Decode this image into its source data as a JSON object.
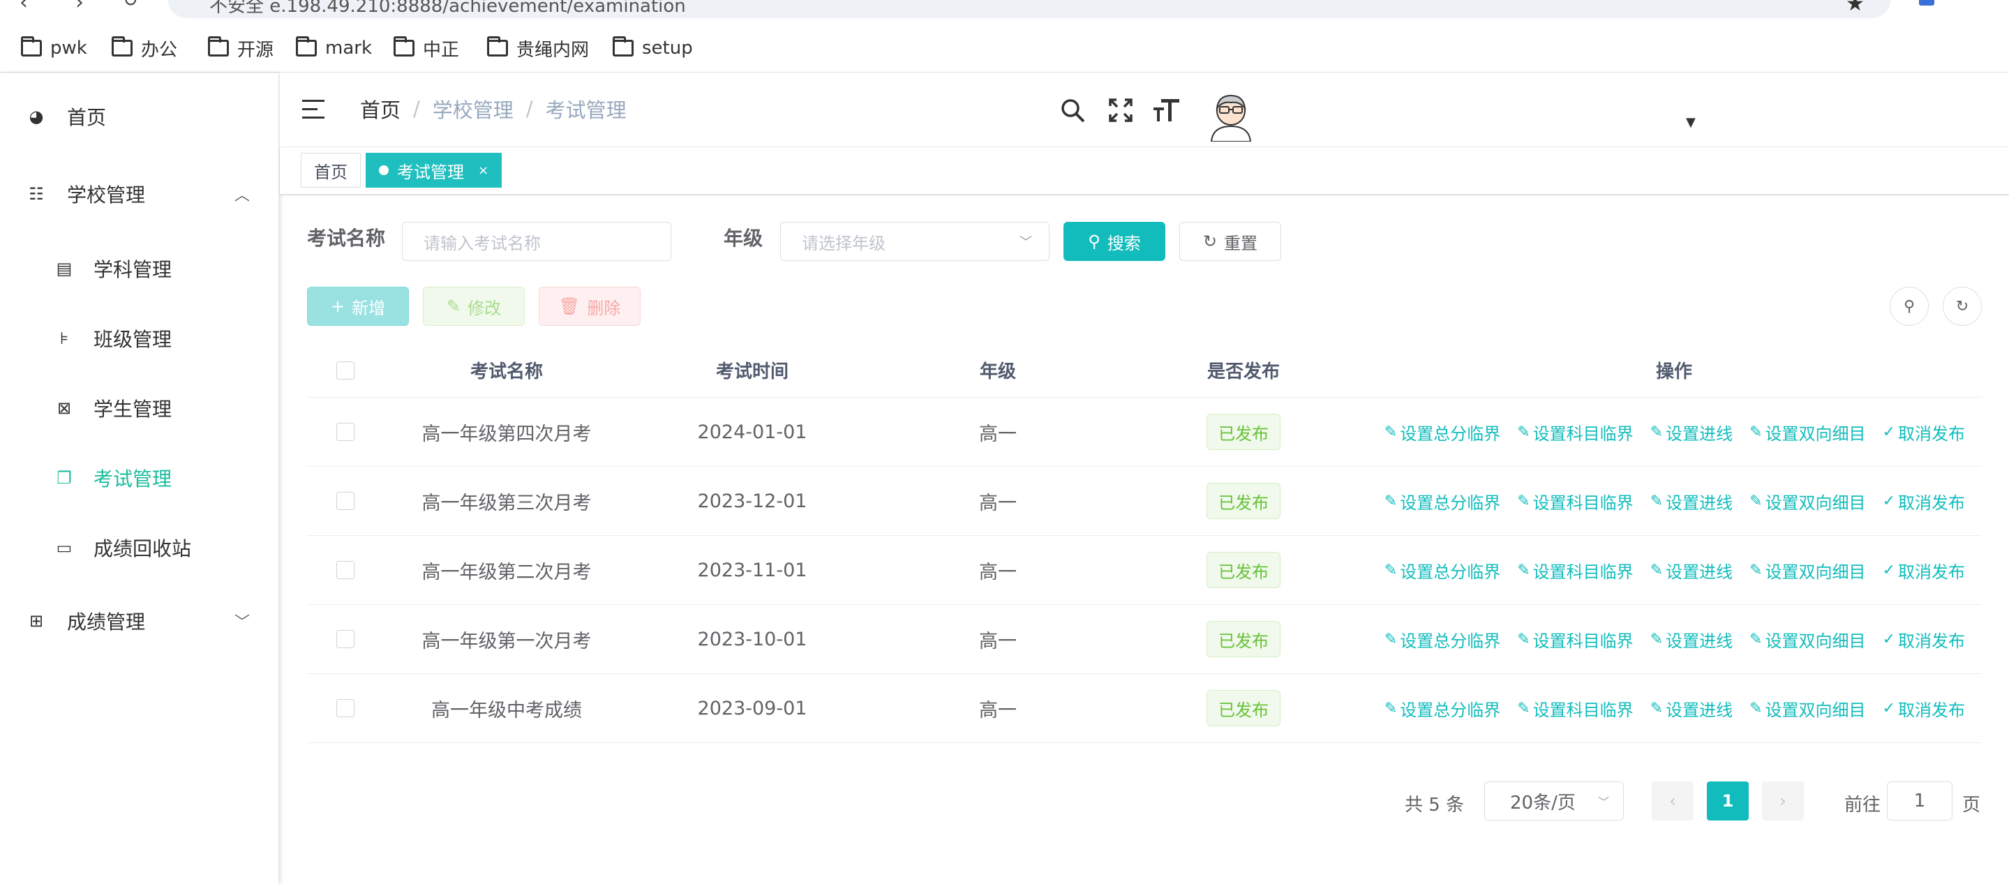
{
  "browser": {
    "address": "e.198.49.210:8888/achievement/examination",
    "security_label": "不安全",
    "bookmarks": [
      "pwk",
      "办公",
      "开源",
      "mark",
      "中正",
      "贵绳内网",
      "setup"
    ]
  },
  "sidebar": {
    "items": [
      {
        "label": "首页",
        "icon": "dashboard-icon"
      },
      {
        "label": "学校管理",
        "icon": "tree-table-icon",
        "expanded": true
      },
      {
        "label": "学科管理",
        "icon": "book-icon"
      },
      {
        "label": "班级管理",
        "icon": "tree-icon"
      },
      {
        "label": "学生管理",
        "icon": "student-icon"
      },
      {
        "label": "考试管理",
        "icon": "documents-icon",
        "active": true
      },
      {
        "label": "成绩回收站",
        "icon": "recycle-icon"
      },
      {
        "label": "成绩管理",
        "icon": "grid-icon",
        "expanded": false
      }
    ],
    "active_color": "#1abc9c"
  },
  "header": {
    "breadcrumb": [
      "首页",
      "学校管理",
      "考试管理"
    ]
  },
  "tags": [
    {
      "label": "首页"
    },
    {
      "label": "考试管理",
      "active": true,
      "close": "×"
    }
  ],
  "search": {
    "name_label": "考试名称",
    "name_placeholder": "请输入考试名称",
    "grade_label": "年级",
    "grade_placeholder": "请选择年级",
    "search_button": "搜索",
    "reset_button": "重置"
  },
  "toolbar": {
    "add": "新增",
    "edit": "修改",
    "delete": "删除"
  },
  "table": {
    "columns": [
      "考试名称",
      "考试时间",
      "年级",
      "是否发布",
      "操作"
    ],
    "rows": [
      {
        "name": "高一年级第四次月考",
        "date": "2024-01-01",
        "grade": "高一",
        "status": "已发布"
      },
      {
        "name": "高一年级第三次月考",
        "date": "2023-12-01",
        "grade": "高一",
        "status": "已发布"
      },
      {
        "name": "高一年级第二次月考",
        "date": "2023-11-01",
        "grade": "高一",
        "status": "已发布"
      },
      {
        "name": "高一年级第一次月考",
        "date": "2023-10-01",
        "grade": "高一",
        "status": "已发布"
      },
      {
        "name": "高一年级中考成绩",
        "date": "2023-09-01",
        "grade": "高一",
        "status": "已发布"
      }
    ],
    "actions": [
      "设置总分临界",
      "设置科目临界",
      "设置进线",
      "设置双向细目",
      "取消发布"
    ]
  },
  "pagination": {
    "total_text": "共 5 条",
    "page_size": "20条/页",
    "current_page": "1",
    "goto_label": "前往",
    "goto_value": "1",
    "page_suffix": "页"
  },
  "colors": {
    "primary": "#13bcbc",
    "success": "#67c23a",
    "danger": "#f56c6c"
  }
}
